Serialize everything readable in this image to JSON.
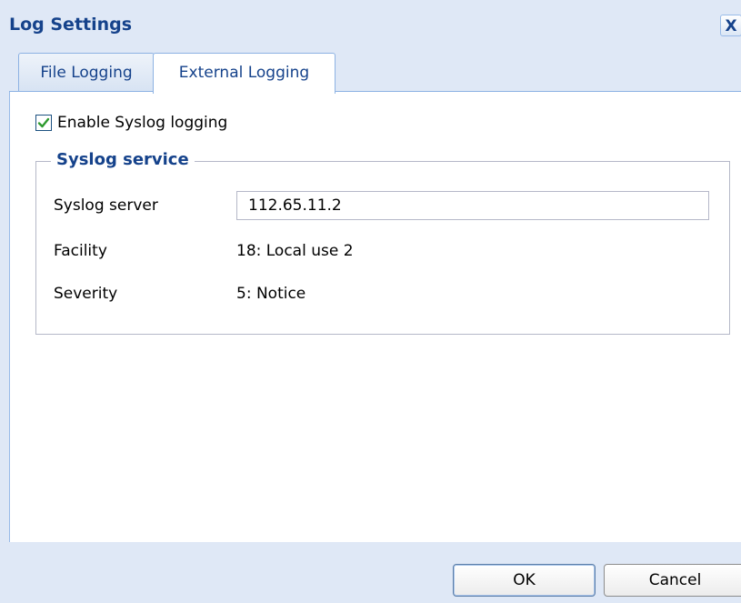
{
  "dialog": {
    "title": "Log Settings",
    "close_label": "X"
  },
  "tabs": [
    {
      "label": "File Logging",
      "active": false
    },
    {
      "label": "External Logging",
      "active": true
    }
  ],
  "external": {
    "enable_checkbox": {
      "label": "Enable Syslog logging",
      "checked": true
    },
    "syslog_service": {
      "legend": "Syslog service",
      "server_label": "Syslog server",
      "server_value": "112.65.11.2",
      "facility_label": "Facility",
      "facility_value": "18: Local use 2",
      "severity_label": "Severity",
      "severity_value": "5: Notice"
    }
  },
  "footer": {
    "ok_label": "OK",
    "cancel_label": "Cancel"
  },
  "colors": {
    "frame": "#dfe8f6",
    "title": "#15428b",
    "tab_border": "#8db2e3",
    "checkmark": "#2e9a2e"
  },
  "icons": {
    "close": "close-icon",
    "check": "checkmark-icon"
  }
}
